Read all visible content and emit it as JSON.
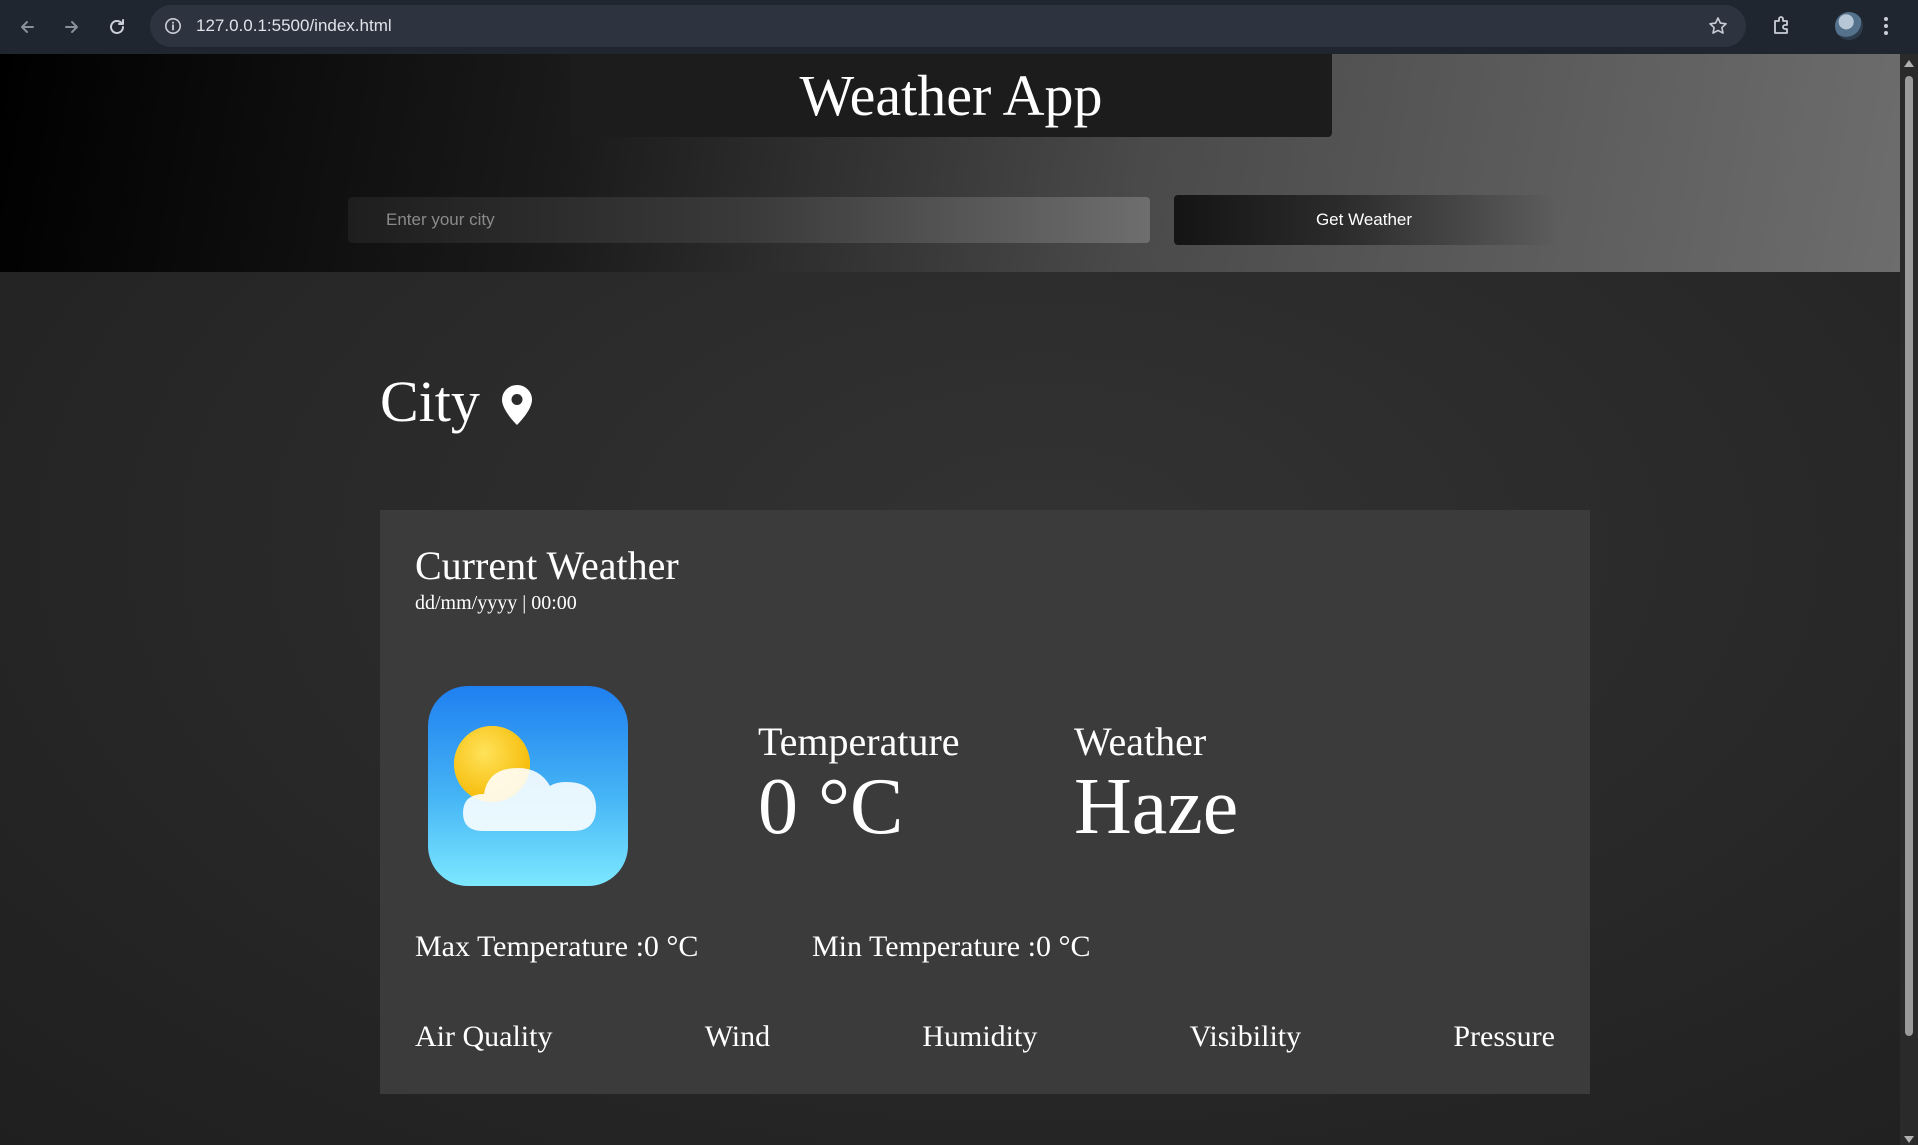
{
  "browser": {
    "url": "127.0.0.1:5500/index.html"
  },
  "app": {
    "title": "Weather App"
  },
  "search": {
    "placeholder": "Enter your city",
    "value": "",
    "button_label": "Get Weather"
  },
  "location": {
    "city": "City"
  },
  "current": {
    "heading": "Current Weather",
    "datetime": "dd/mm/yyyy | 00:00",
    "temperature_label": "Temperature",
    "temperature_value": "0 °C",
    "weather_label": "Weather",
    "weather_value": "Haze",
    "max_temp": "Max Temperature :0 °C",
    "min_temp": "Min Temperature :0 °C"
  },
  "metrics": [
    "Air Quality",
    "Wind",
    "Humidity",
    "Visibility",
    "Pressure"
  ],
  "icons": {
    "back": "arrow-left-icon",
    "forward": "arrow-right-icon",
    "reload": "reload-icon",
    "site_info": "info-icon",
    "bookmark": "star-icon",
    "extensions": "puzzle-icon",
    "menu": "kebab-menu-icon",
    "location": "map-pin-icon",
    "weather": "partly-cloudy-icon"
  },
  "colors": {
    "page_bg": "#2a2a2a",
    "card_bg": "#3b3b3b",
    "title_bg": "#1c1c1c",
    "text": "#ffffff",
    "weather_icon_top": "#1f7ff0",
    "weather_icon_bottom": "#7de8ff"
  }
}
